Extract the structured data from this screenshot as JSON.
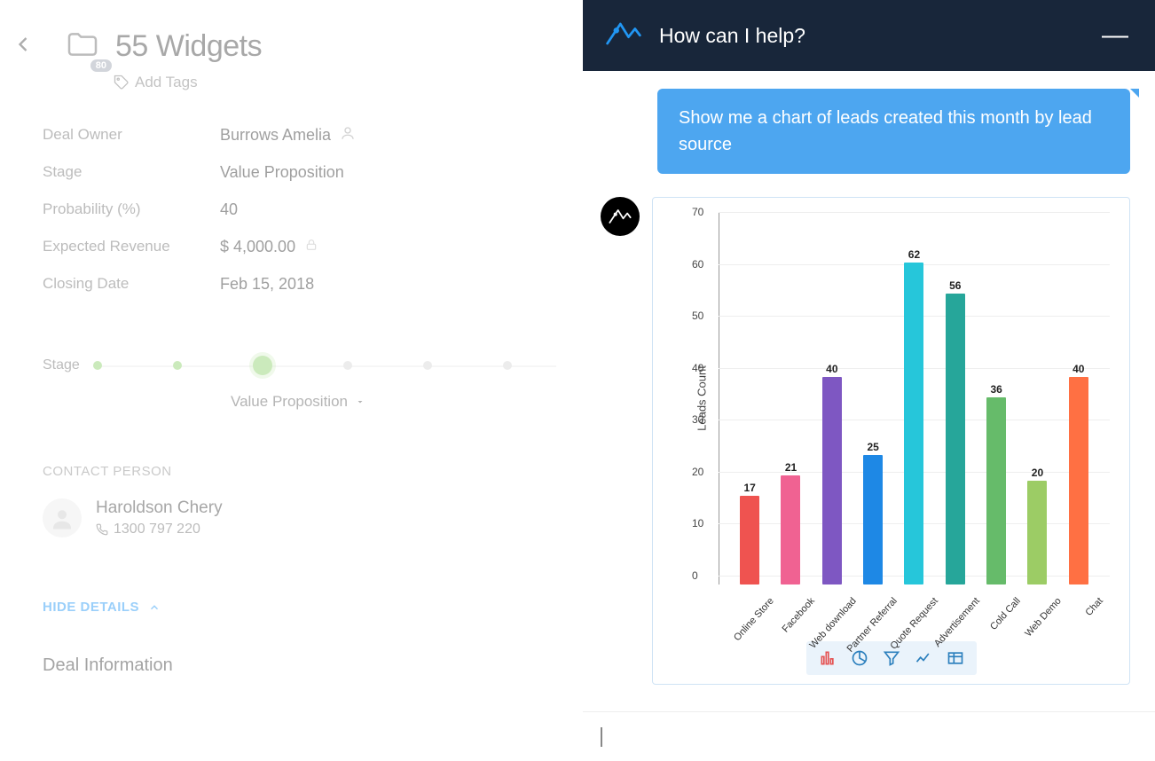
{
  "deal": {
    "title": "55 Widgets",
    "badge": "80",
    "add_tags_label": "Add Tags",
    "fields": {
      "owner_label": "Deal Owner",
      "owner_value": "Burrows Amelia",
      "stage_label": "Stage",
      "stage_value": "Value Proposition",
      "probability_label": "Probability (%)",
      "probability_value": "40",
      "revenue_label": "Expected Revenue",
      "revenue_value": "$ 4,000.00",
      "closing_label": "Closing Date",
      "closing_value": "Feb 15, 2018"
    },
    "stage_strip_label": "Stage",
    "stage_dropdown_value": "Value Proposition",
    "contact_section_h": "CONTACT PERSON",
    "contact_name": "Haroldson Chery",
    "contact_phone": "1300 797 220",
    "hide_details_label": "HIDE DETAILS",
    "deal_info_h": "Deal Information"
  },
  "zia": {
    "header_title": "How can I help?",
    "user_message": "Show me a chart of leads created this month by lead source"
  },
  "chart_data": {
    "type": "bar",
    "ylabel": "Leads Count",
    "ylim": [
      0,
      70
    ],
    "yticks": [
      0,
      10,
      20,
      30,
      40,
      50,
      60,
      70
    ],
    "categories": [
      "Online Store",
      "Facebook",
      "Web download",
      "Partner Referral",
      "Quote Request",
      "Advertisement",
      "Cold Call",
      "Web Demo",
      "Chat"
    ],
    "values": [
      17,
      21,
      40,
      25,
      62,
      56,
      36,
      20,
      40
    ],
    "colors": [
      "#ef5350",
      "#f06292",
      "#7e57c2",
      "#1e88e5",
      "#26c6da",
      "#26a69a",
      "#66bb6a",
      "#9ccc65",
      "#ff7043"
    ]
  },
  "chart_toolbar": {
    "bar_icon": "bar-chart-icon",
    "pie_icon": "pie-chart-icon",
    "funnel_icon": "funnel-icon",
    "line_icon": "line-chart-icon",
    "table_icon": "table-icon"
  }
}
